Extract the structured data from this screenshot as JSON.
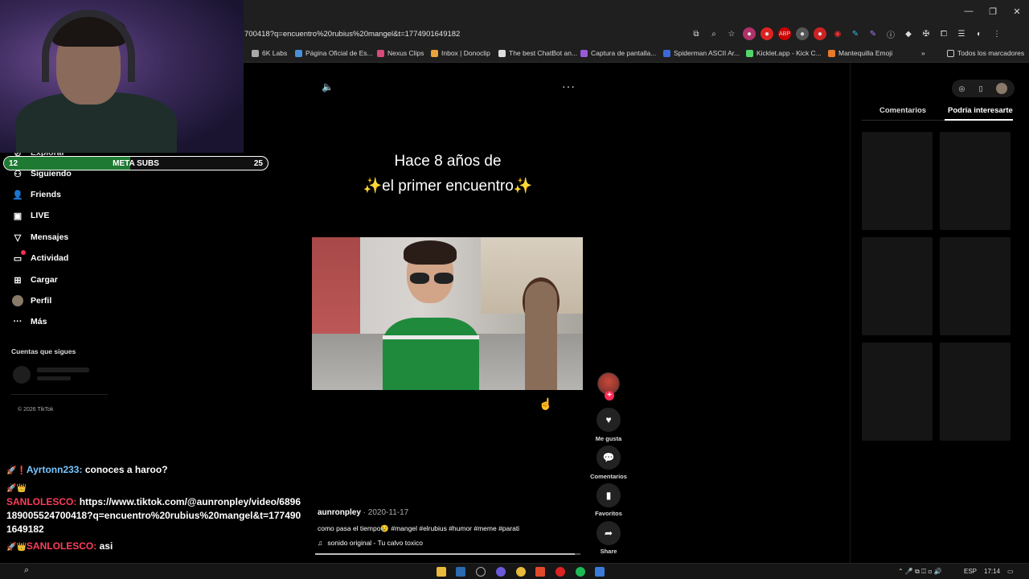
{
  "browser": {
    "url": "700418?q=encuentro%20rubius%20mangel&t=1774901649182",
    "window_controls": [
      "—",
      "❐",
      "✕"
    ],
    "bookmarks": [
      {
        "label": "6K Labs",
        "color": "#aaaaaa"
      },
      {
        "label": "Página Oficial de Es...",
        "color": "#4a90d9"
      },
      {
        "label": "Nexus Clips",
        "color": "#d94a7a"
      },
      {
        "label": "Inbox | Donoclip",
        "color": "#e8a33a"
      },
      {
        "label": "The best ChatBot an...",
        "color": "#dddddd"
      },
      {
        "label": "Captura de pantalla...",
        "color": "#9a5ad9"
      },
      {
        "label": "Spiderman ASCII Ar...",
        "color": "#3a6ad9"
      },
      {
        "label": "Kicklet.app - Kick C...",
        "color": "#53d769"
      },
      {
        "label": "Mantequilla Emoji",
        "color": "#e87a2a"
      }
    ],
    "bookmarks_more": "»",
    "all_bookmarks": "Todos los marcadores"
  },
  "stream": {
    "meta_left": "12",
    "meta_label": "META SUBS",
    "meta_right": "25",
    "meta_progress": 0.48,
    "chat": [
      {
        "badges": "🚀❗",
        "user": "Ayrtonn233:",
        "message": "conoces a haroo?",
        "color": "#7bc6ff"
      },
      {
        "badges": "🚀👑",
        "user": "SANLOLESCO:",
        "message": "https://www.tiktok.com/@aunronpley/video/6896189005524700418?q=encuentro%20rubius%20mangel&t=1774901649182",
        "color": "#ff3d5a"
      },
      {
        "badges": "🚀👑",
        "user": "SANLOLESCO:",
        "message": "asi",
        "color": "#ff3d5a"
      }
    ]
  },
  "sidebar": {
    "partial_items": [
      "Explorar",
      "Siguiendo"
    ],
    "items": [
      {
        "label": "Friends",
        "icon": "friends-icon",
        "glyph": "👤"
      },
      {
        "label": "LIVE",
        "icon": "live-icon",
        "glyph": "▣"
      },
      {
        "label": "Mensajes",
        "icon": "messages-icon",
        "glyph": "▽"
      },
      {
        "label": "Actividad",
        "icon": "activity-icon",
        "glyph": "▭"
      },
      {
        "label": "Cargar",
        "icon": "upload-icon",
        "glyph": "⊞"
      },
      {
        "label": "Perfil",
        "icon": "profile-avatar-icon",
        "glyph": ""
      },
      {
        "label": "Más",
        "icon": "more-icon",
        "glyph": "···"
      }
    ],
    "following_title": "Cuentas que sigues",
    "copyright": "© 2026 TikTok"
  },
  "video": {
    "caption_line1": "Hace 8 años de",
    "caption_line2": "el primer encuentro",
    "sparkle": "✨",
    "author": "aunronpley",
    "date": " · 2020-11-17",
    "description": "como pasa el tiempo😢 #mangel #elrubius #humor #meme #parati",
    "sound": "sonido original - Tu calvo toxico",
    "progress": 0.98
  },
  "actions": [
    {
      "label": "Me gusta",
      "icon": "heart-icon",
      "glyph": "♥"
    },
    {
      "label": "Comentarios",
      "icon": "comment-icon",
      "glyph": "●"
    },
    {
      "label": "Favoritos",
      "icon": "bookmark-icon",
      "glyph": "▮"
    },
    {
      "label": "Share",
      "icon": "share-icon",
      "glyph": "➦"
    }
  ],
  "right_panel": {
    "tab_comments": "Comentarios",
    "tab_interest": "Podría interesarte"
  },
  "taskbar": {
    "lang": "ESP",
    "time": "17:14"
  }
}
